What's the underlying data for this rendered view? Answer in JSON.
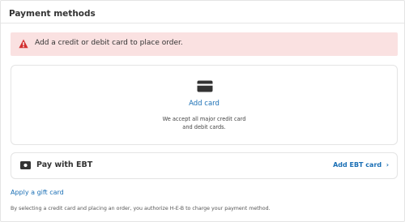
{
  "header": {
    "title": "Payment methods"
  },
  "alert": {
    "message": "Add a credit or debit card to place order.",
    "icon": "warning-icon",
    "color": "#d32f2f",
    "background": "#fae1e1"
  },
  "card": {
    "icon": "credit-card-icon",
    "add_label": "Add card",
    "accept_line1": "We accept all major credit card",
    "accept_line2": "and debit cards."
  },
  "ebt": {
    "icon": "ebt-card-icon",
    "label": "Pay with EBT",
    "action_label": "Add EBT card",
    "action_icon": "chevron-right-icon"
  },
  "gift": {
    "label": "Apply a gift card"
  },
  "legal": {
    "text": "By selecting a credit card and placing an order, you authorize H-E-B to charge your payment method."
  },
  "colors": {
    "link": "#1a6fb5",
    "border": "#e4e4e4"
  }
}
